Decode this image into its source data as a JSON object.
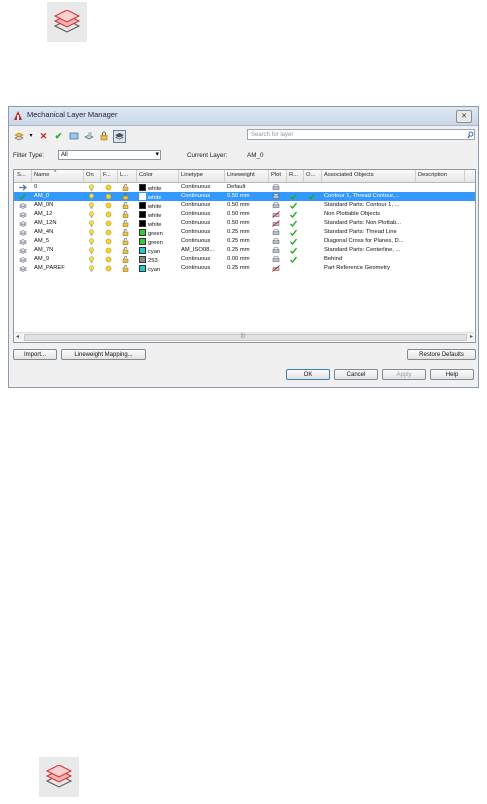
{
  "window": {
    "title": "Mechanical Layer Manager",
    "close_glyph": "✕"
  },
  "toolbar": {
    "icons": [
      "new-layer-icon",
      "dropdown-arrow-icon",
      "delete-icon",
      "set-current-icon",
      "layer-states-icon",
      "freeze-icon",
      "lock-icon",
      "refresh-icon"
    ]
  },
  "search": {
    "placeholder": "Search for layer"
  },
  "filter": {
    "label": "Filter Type:",
    "value": "All"
  },
  "current_layer": {
    "label": "Current Layer:",
    "value": "AM_0"
  },
  "table": {
    "columns": [
      "S...",
      "Name",
      "On",
      "F...",
      "L...",
      "Color",
      "Linetype",
      "Lineweight",
      "Plot",
      "R...",
      "O...",
      "Associated Objects",
      "Description"
    ],
    "rows": [
      {
        "name": "0",
        "color": "white",
        "color_hex": "#000000",
        "linetype": "Continuous",
        "lineweight": "Default",
        "plot": true,
        "r": false,
        "o": false,
        "assoc": "",
        "desc": "",
        "selected": false,
        "state": "arrow"
      },
      {
        "name": "AM_0",
        "color": "white",
        "color_hex": "#ffffff",
        "linetype": "Continuous",
        "lineweight": "0.50 mm",
        "plot": true,
        "r": true,
        "o": true,
        "assoc": "Contour 1, Thread Contour,...",
        "desc": "",
        "selected": true,
        "state": "check"
      },
      {
        "name": "AM_0N",
        "color": "white",
        "color_hex": "#000000",
        "linetype": "Continuous",
        "lineweight": "0.50 mm",
        "plot": true,
        "r": true,
        "o": false,
        "assoc": "Standard Parts: Contour 1, ...",
        "desc": "",
        "selected": false,
        "state": "layer"
      },
      {
        "name": "AM_12",
        "color": "white",
        "color_hex": "#000000",
        "linetype": "Continuous",
        "lineweight": "0.50 mm",
        "plot": false,
        "r": true,
        "o": false,
        "assoc": "Non Plottable Objects",
        "desc": "",
        "selected": false,
        "state": "layer"
      },
      {
        "name": "AM_12N",
        "color": "white",
        "color_hex": "#000000",
        "linetype": "Continuous",
        "lineweight": "0.50 mm",
        "plot": false,
        "r": true,
        "o": false,
        "assoc": "Standard Parts: Non Plottab...",
        "desc": "",
        "selected": false,
        "state": "layer"
      },
      {
        "name": "AM_4N",
        "color": "green",
        "color_hex": "#33cc33",
        "linetype": "Continuous",
        "lineweight": "0.25 mm",
        "plot": true,
        "r": true,
        "o": false,
        "assoc": "Standard Parts: Thread Line",
        "desc": "",
        "selected": false,
        "state": "layer"
      },
      {
        "name": "AM_5",
        "color": "green",
        "color_hex": "#33cc33",
        "linetype": "Continuous",
        "lineweight": "0.25 mm",
        "plot": true,
        "r": true,
        "o": false,
        "assoc": "Diagonal Cross for Planes, D...",
        "desc": "",
        "selected": false,
        "state": "layer"
      },
      {
        "name": "AM_7N",
        "color": "cyan",
        "color_hex": "#22cccc",
        "linetype": "AM_ISO08...",
        "lineweight": "0.25 mm",
        "plot": true,
        "r": true,
        "o": false,
        "assoc": "Standard Parts: Centerline, ...",
        "desc": "",
        "selected": false,
        "state": "layer"
      },
      {
        "name": "AM_9",
        "color": "253",
        "color_hex": "#8a8a8a",
        "linetype": "Continuous",
        "lineweight": "0.00 mm",
        "plot": true,
        "r": true,
        "o": false,
        "assoc": "Behind",
        "desc": "",
        "selected": false,
        "state": "layer"
      },
      {
        "name": "AM_PAREF",
        "color": "cyan",
        "color_hex": "#22cccc",
        "linetype": "Continuous",
        "lineweight": "0.25 mm",
        "plot": false,
        "r": false,
        "o": false,
        "assoc": "Part Reference Geometry",
        "desc": "",
        "selected": false,
        "state": "layer"
      }
    ]
  },
  "scrollbar": {
    "grip": "|||"
  },
  "buttons": {
    "import": "Import...",
    "lineweight_mapping": "Lineweight Mapping...",
    "restore_defaults": "Restore Defaults",
    "ok": "OK",
    "cancel": "Cancel",
    "apply": "Apply",
    "help": "Help"
  },
  "colors": {
    "selection": "#3399ff",
    "check": "#22aa22",
    "bulb": "#f5e04a",
    "delete": "#cc2222"
  }
}
